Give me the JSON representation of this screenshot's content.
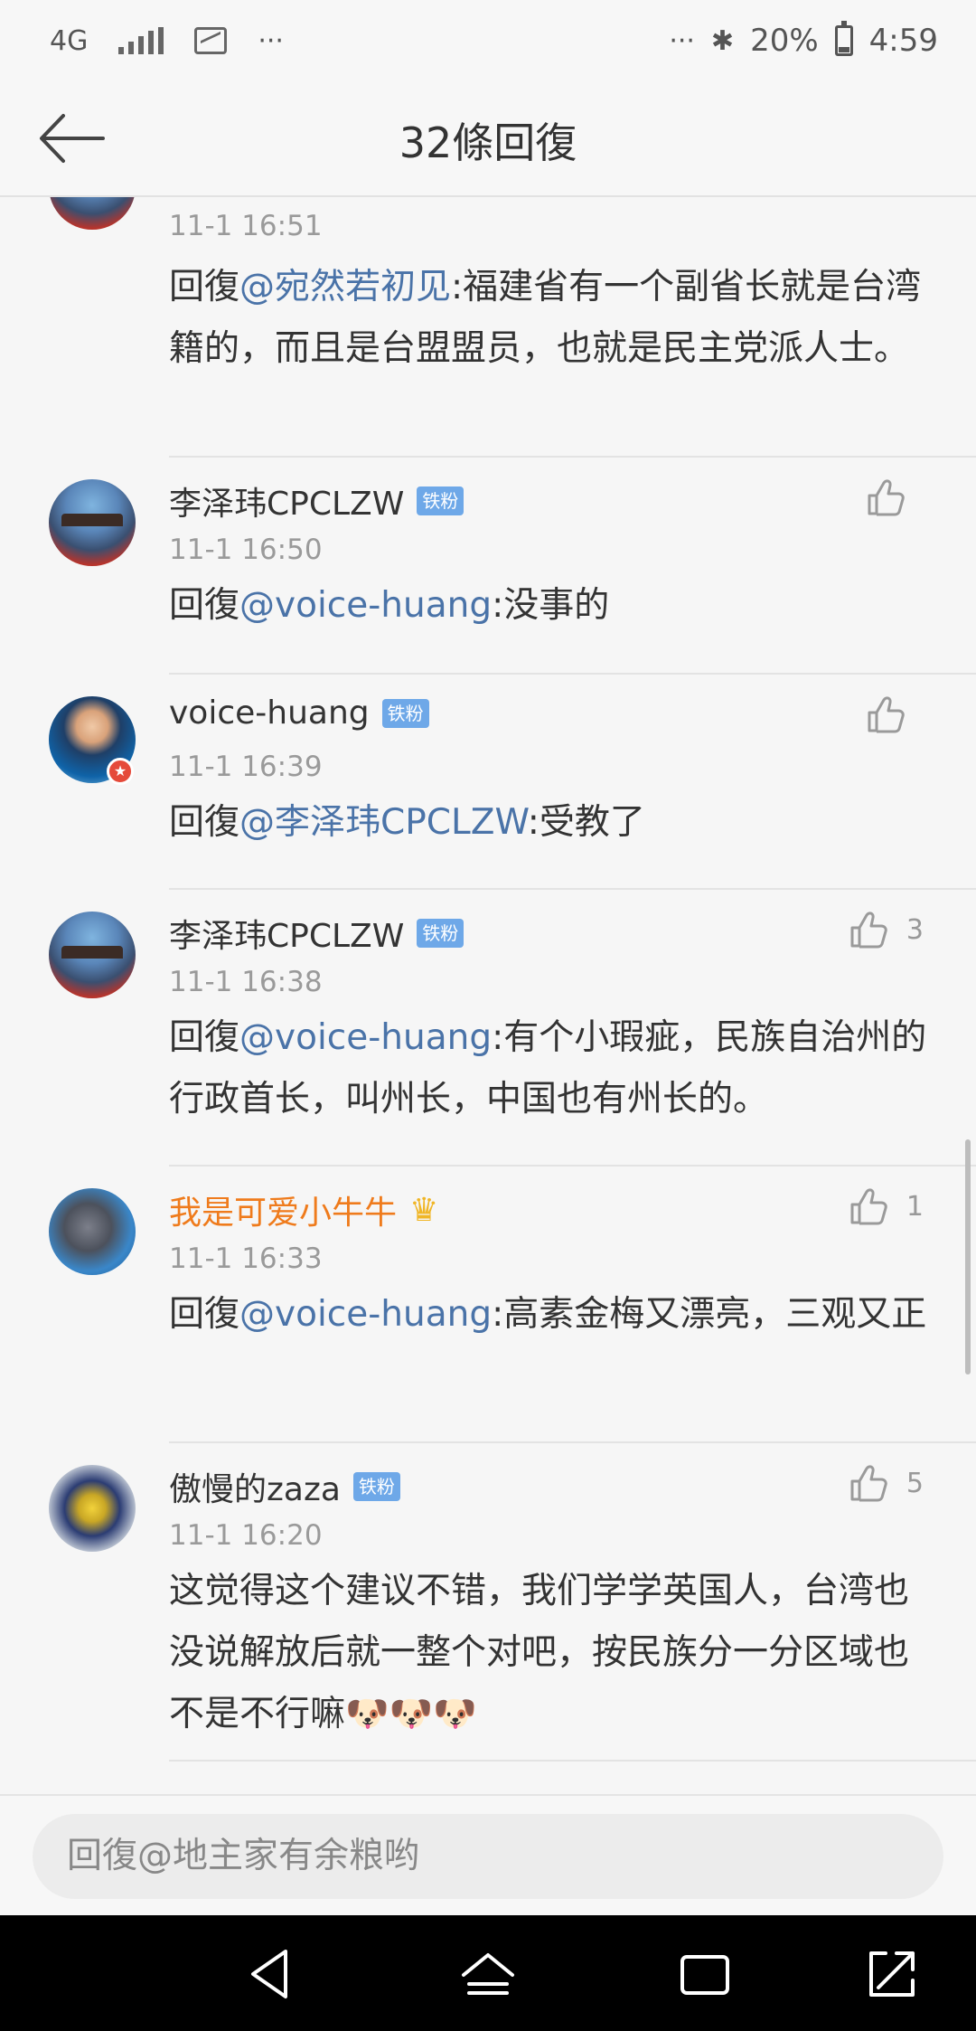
{
  "status_bar": {
    "network": "4G",
    "dots_left": "···",
    "dots_right": "···",
    "bluetooth": "✱",
    "battery": "20%",
    "time": "4:59"
  },
  "header": {
    "title": "32條回復"
  },
  "comments": [
    {
      "name": "",
      "time": "11-1 16:51",
      "body_prefix": "回復",
      "mention": "@宛然若初见",
      "body_text": ":福建省有一个副省长就是台湾籍的，而且是台盟盟员，也就是民主党派人士。"
    },
    {
      "name": "李泽玮CPCLZW",
      "badge": "铁粉",
      "time": "11-1 16:50",
      "body_prefix": "回復",
      "mention": "@voice-huang",
      "body_text": ":没事的",
      "likes": ""
    },
    {
      "name": "voice-huang",
      "badge": "铁粉",
      "time": "11-1 16:39",
      "body_prefix": "回復",
      "mention": "@李泽玮CPCLZW",
      "body_text": ":受教了",
      "likes": ""
    },
    {
      "name": "李泽玮CPCLZW",
      "badge": "铁粉",
      "time": "11-1 16:38",
      "body_prefix": "回復",
      "mention": "@voice-huang",
      "body_text": ":有个小瑕疵，民族自治州的行政首长，叫州长，中国也有州长的。",
      "likes": "3"
    },
    {
      "name": "我是可爱小牛牛",
      "time": "11-1 16:33",
      "body_prefix": "回復",
      "mention": "@voice-huang",
      "body_text": ":高素金梅又漂亮，三观又正",
      "likes": "1"
    },
    {
      "name": "傲慢的zaza",
      "badge": "铁粉",
      "time": "11-1 16:20",
      "body_text": "这觉得这个建议不错，我们学学英国人，台湾也没说解放后就一整个对吧，按民族分一分区域也不是不行嘛",
      "emoji": "🐶🐶🐶",
      "likes": "5"
    }
  ],
  "reply_bar": {
    "placeholder": "回復@地主家有余粮哟"
  },
  "colors": {
    "mention": "#4a73a8",
    "badge": "#6ea8e8",
    "orange_name": "#ef7b1c",
    "background": "#f6f6f6"
  },
  "icons": [
    "back-arrow-icon",
    "thumb-up-icon",
    "nav-back-icon",
    "nav-home-icon",
    "nav-recents-icon",
    "nav-rotate-icon"
  ]
}
